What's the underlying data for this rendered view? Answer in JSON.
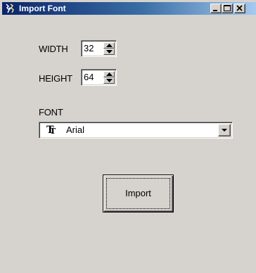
{
  "window": {
    "title": "Import Font",
    "icon": "import-font-app-icon",
    "controls": {
      "minimize": "minimize-icon",
      "maximize": "maximize-icon",
      "close": "close-icon"
    }
  },
  "form": {
    "width_label": "WIDTH",
    "width_value": "32",
    "height_label": "HEIGHT",
    "height_value": "64",
    "font_label": "FONT",
    "font_value": "Arial",
    "font_icon": "truetype-font-icon"
  },
  "buttons": {
    "import_label": "Import"
  },
  "colors": {
    "titlebar_start": "#0a246a",
    "titlebar_end": "#a6caf0",
    "face": "#d6d3ce"
  }
}
